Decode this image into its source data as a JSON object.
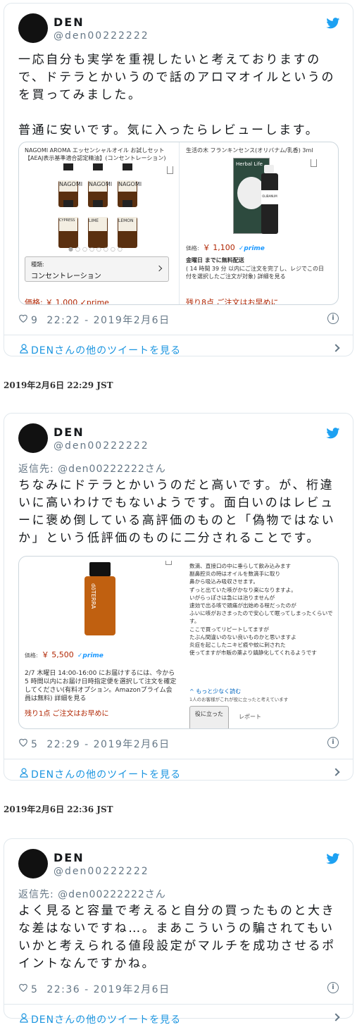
{
  "tweets": [
    {
      "name": "DEN",
      "handle": "@den00222222",
      "reply_to": "",
      "text": "一応自分も実学を重視したいと考えておりますので、ドテラとかいうので話のアロマオイルというのを買ってみました。\n\n普通に安いです。気に入ったらレビューします。",
      "likes": "9",
      "time": "22:22 - 2019年2月6日",
      "more": "DENさんの他のツイートを見る",
      "media": {
        "left_title": "NAGOMI AROMA エッセンシャルオイル お試しセット【AEAJ表示基準適合認定精油】(コンセントレーション)",
        "left_kind_label": "種類:",
        "left_kind_value": "コンセントレーション",
        "left_price_cut": "価格: ￥ 1,000 ✓prime",
        "bottles": [
          "NAGOMI",
          "NAGOMI",
          "NAGOMI",
          "CYPRESS",
          "LIME",
          "LEMON"
        ],
        "right_title": "生活の木 フランキンセンス(オリバナム/乳香) 3ml",
        "right_bottle_brand": "Herbal Life",
        "right_bottle_label": "OLIBANUM",
        "right_price_label": "価格:",
        "right_price": "￥ 1,100",
        "prime": "✓prime",
        "delivery": "金曜日 までに無料配送",
        "delivery_note": "( 14 時間 39 分 以内にご注文を完了し、レジでこの日付を選択したご注文が対象) 詳細を見る",
        "stock": "残り8点 ご注文はお早めに"
      }
    },
    {
      "name": "DEN",
      "handle": "@den00222222",
      "reply_to": "返信先: @den00222222さん",
      "text": "ちなみにドテラとかいうのだと高いです。が、桁違いに高いわけでもないようです。面白いのはレビューに褒め倒している高評価のものと「偽物ではないか」という低評価のものに二分されることです。",
      "likes": "5",
      "time": "22:29 - 2019年2月6日",
      "more": "DENさんの他のツイートを見る",
      "media": {
        "bottle_brand": "dōTERRA",
        "price_label": "価格:",
        "price": "￥ 5,500",
        "prime": "✓prime",
        "delivery": "2/7 木曜日 14:00-16:00 にお届けするには、今から5 時間以内にお届け日時指定便を選択して注文を確定してください(有料オプション。Amazonプライム会員は無料) 詳細を見る",
        "stock": "残り1点 ご注文はお早めに",
        "review": "数滴、直接口の中に垂らして飲み込みます\n副鼻腔炎の時はオイルを数滴手に取り\n鼻から吸込み吸収させます。\nずっと出ていた咳がかなり楽になりますよ。\nいがらっぽさは急には治りませんが\n速効で出る咳で頭痛が出始める程だったのが\nふいに咳がおさまったので安心して眠ってしまったくらいです。\nここで買ってリピートしてますが\nたぶん間違いのない良いものかと思いますよ\n炎症を起こしたニキビ痕や蚊に刺された\n使ってますが市販の薬より鎮静化してくれるようです",
        "less": "^ もっと少なく読む",
        "helpful_count": "1人のお客様がこれが役に立ったと考えています",
        "helpful_btn": "役に立った",
        "report": "レポート"
      }
    },
    {
      "name": "DEN",
      "handle": "@den00222222",
      "reply_to": "返信先: @den00222222さん",
      "text": "よく見ると容量で考えると自分の買ったものと大きな差はないですね…。まあこういうの騙されてもいいかと考えられる値段設定がマルチを成功させるポイントなんですかね。",
      "likes": "5",
      "time": "22:36 - 2019年2月6日",
      "more": "DENさんの他のツイートを見る"
    }
  ],
  "timestamps": [
    "2019年2月6日 22:29 JST",
    "2019年2月6日 22:36 JST"
  ],
  "colors": {
    "link": "#1b95e0",
    "muted": "#657786",
    "border": "#e1e8ed",
    "price": "#b12704",
    "bird": "#1da1f2"
  }
}
